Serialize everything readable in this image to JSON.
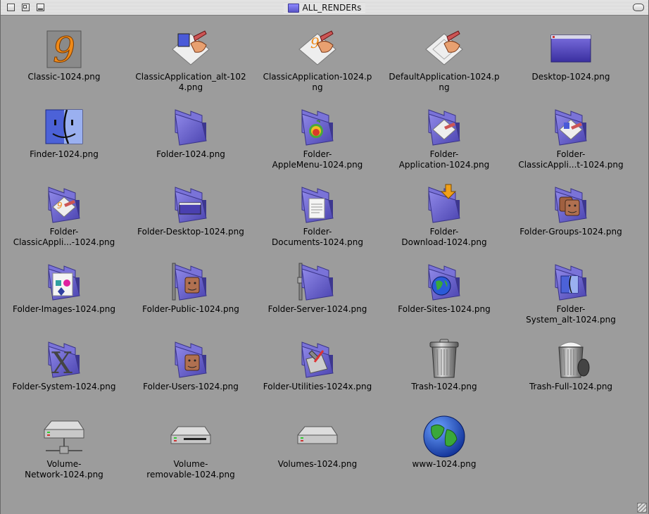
{
  "window": {
    "title": "ALL_RENDERs"
  },
  "items": [
    {
      "icon": "classic-nine-icon",
      "lines": [
        "Classic-1024.png"
      ]
    },
    {
      "icon": "classic-application-alt-icon",
      "lines": [
        "ClassicApplication_alt-102",
        "4.png"
      ]
    },
    {
      "icon": "classic-application-icon",
      "lines": [
        "ClassicApplication-1024.p",
        "ng"
      ]
    },
    {
      "icon": "default-application-icon",
      "lines": [
        "DefaultApplication-1024.p",
        "ng"
      ]
    },
    {
      "icon": "desktop-window-icon",
      "lines": [
        "Desktop-1024.png"
      ]
    },
    {
      "icon": "finder-face-icon",
      "lines": [
        "Finder-1024.png"
      ]
    },
    {
      "icon": "folder-icon",
      "lines": [
        "Folder-1024.png"
      ]
    },
    {
      "icon": "folder-apple-menu-icon",
      "lines": [
        "Folder-",
        "AppleMenu-1024.png"
      ]
    },
    {
      "icon": "folder-application-icon",
      "lines": [
        "Folder-",
        "Application-1024.png"
      ]
    },
    {
      "icon": "folder-classic-application-icon",
      "lines": [
        "Folder-",
        "ClassicAppli...t-1024.png"
      ]
    },
    {
      "icon": "folder-classic-application-2-icon",
      "lines": [
        "Folder-",
        "ClassicAppli...-1024.png"
      ]
    },
    {
      "icon": "folder-desktop-icon",
      "lines": [
        "Folder-Desktop-1024.png"
      ]
    },
    {
      "icon": "folder-documents-icon",
      "lines": [
        "Folder-",
        "Documents-1024.png"
      ]
    },
    {
      "icon": "folder-download-icon",
      "lines": [
        "Folder-",
        "Download-1024.png"
      ]
    },
    {
      "icon": "folder-groups-icon",
      "lines": [
        "Folder-Groups-1024.png"
      ]
    },
    {
      "icon": "folder-images-icon",
      "lines": [
        "Folder-Images-1024.png"
      ]
    },
    {
      "icon": "folder-public-icon",
      "lines": [
        "Folder-Public-1024.png"
      ]
    },
    {
      "icon": "folder-server-icon",
      "lines": [
        "Folder-Server-1024.png"
      ]
    },
    {
      "icon": "folder-sites-icon",
      "lines": [
        "Folder-Sites-1024.png"
      ]
    },
    {
      "icon": "folder-system-alt-icon",
      "lines": [
        "Folder-",
        "System_alt-1024.png"
      ]
    },
    {
      "icon": "folder-system-icon",
      "lines": [
        "Folder-System-1024.png"
      ]
    },
    {
      "icon": "folder-users-icon",
      "lines": [
        "Folder-Users-1024.png"
      ]
    },
    {
      "icon": "folder-utilities-icon",
      "lines": [
        "Folder-Utilities-1024x.png"
      ]
    },
    {
      "icon": "trash-icon",
      "lines": [
        "Trash-1024.png"
      ]
    },
    {
      "icon": "trash-full-icon",
      "lines": [
        "Trash-Full-1024.png"
      ]
    },
    {
      "icon": "volume-network-icon",
      "lines": [
        "Volume-",
        "Network-1024.png"
      ]
    },
    {
      "icon": "volume-removable-icon",
      "lines": [
        "Volume-",
        "removable-1024.png"
      ]
    },
    {
      "icon": "volumes-drive-icon",
      "lines": [
        "Volumes-1024.png"
      ]
    },
    {
      "icon": "www-globe-icon",
      "lines": [
        "www-1024.png"
      ]
    }
  ]
}
